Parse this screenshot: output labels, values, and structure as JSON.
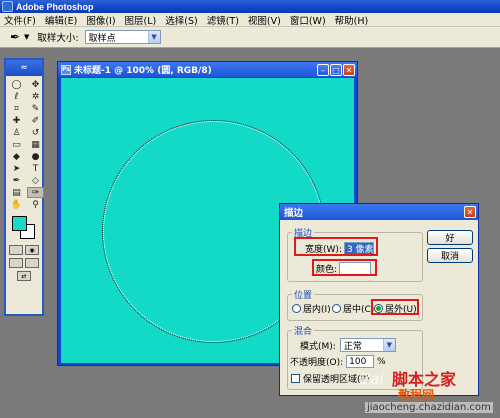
{
  "app": {
    "title": "Adobe Photoshop"
  },
  "menu": [
    "文件(F)",
    "编辑(E)",
    "图像(I)",
    "图层(L)",
    "选择(S)",
    "滤镜(T)",
    "视图(V)",
    "窗口(W)",
    "帮助(H)"
  ],
  "options": {
    "sample_size_label": "取样大小:",
    "sample_size_value": "取样点",
    "tool_icon": "eyedropper-icon"
  },
  "document": {
    "title": "未标题-1 @ 100% (圆, RGB/8)",
    "canvas_color": "#13d9c7"
  },
  "colors": {
    "foreground": "#19d9c8",
    "background": "#ffffff"
  },
  "stroke_dialog": {
    "title": "描边",
    "stroke_group": "描边",
    "width_label": "宽度(W):",
    "width_value": "3 像素",
    "color_label": "颜色:",
    "position_group": "位置",
    "pos_inside": "居内(I)",
    "pos_center": "居中(C)",
    "pos_outside": "居外(U)",
    "selected_position": "outside",
    "blend_group": "混合",
    "mode_label": "模式(M):",
    "mode_value": "正常",
    "opacity_label": "不透明度(O):",
    "opacity_value": "100",
    "opacity_unit": "%",
    "preserve_label": "保留透明区域(P)",
    "ok": "好",
    "cancel": "取消"
  },
  "watermark": {
    "baidu": "Bai",
    "site_cn": "脚本之家",
    "site_cn2": "教程网",
    "site_url": "jiaocheng.chazidian.com"
  }
}
